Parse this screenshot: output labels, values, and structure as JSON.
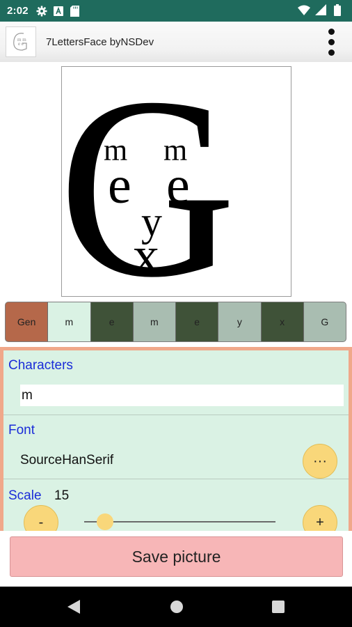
{
  "status_bar": {
    "time": "2:02",
    "left_icons": [
      "gear-icon",
      "a-box-icon",
      "sd-card-icon"
    ],
    "right_icons": [
      "wifi-icon",
      "signal-icon",
      "battery-icon"
    ]
  },
  "app_bar": {
    "title": "7LettersFace byNSDev",
    "menu_icon": "overflow-menu-icon"
  },
  "preview": {
    "glyphs": [
      "G",
      "m",
      "m",
      "e",
      "e",
      "y",
      "x"
    ]
  },
  "slots": [
    {
      "label": "Gen",
      "color": "#b5684a"
    },
    {
      "label": "m",
      "color": "#daf2e4"
    },
    {
      "label": "e",
      "color": "#3f5238"
    },
    {
      "label": "m",
      "color": "#a9bdb1"
    },
    {
      "label": "e",
      "color": "#3f5238"
    },
    {
      "label": "y",
      "color": "#a9bdb1"
    },
    {
      "label": "x",
      "color": "#3f5238"
    },
    {
      "label": "G",
      "color": "#a9bdb1"
    }
  ],
  "settings": {
    "characters_label": "Characters",
    "characters_value": "m",
    "font_label": "Font",
    "font_value": "SourceHanSerif",
    "font_button": "···",
    "scale_label": "Scale",
    "scale_value": "15",
    "scale_decrease": "-",
    "scale_increase": "+",
    "scale_position": 0.1
  },
  "save_button": "Save picture",
  "colors": {
    "status_bar": "#1f6b5d",
    "panel_bg": "#daf2e4",
    "panel_border": "#f0a88a",
    "section_label": "#1a2cd8",
    "button_yellow": "#f9d77a",
    "save_pink": "#f7b6b7"
  },
  "nav_bar": [
    "back-icon",
    "home-icon",
    "recents-icon"
  ]
}
